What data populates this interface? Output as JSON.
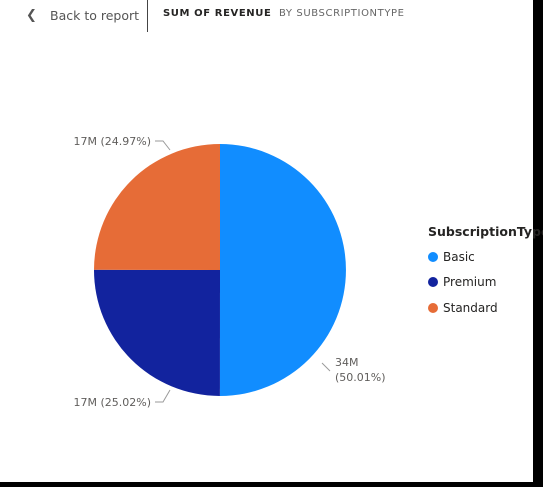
{
  "header": {
    "back_label": "Back to report",
    "metric": "SUM OF REVENUE",
    "dimension": "BY SUBSCRIPTIONTYPE"
  },
  "icons": {
    "back": "chevron-left-icon"
  },
  "colors": {
    "Basic": "#118DFF",
    "Premium": "#12239E",
    "Standard": "#E66C37"
  },
  "chart_data": {
    "type": "pie",
    "categories": [
      "Basic",
      "Premium",
      "Standard"
    ],
    "values": [
      34,
      17,
      17
    ],
    "percentages": [
      50.01,
      25.02,
      24.97
    ],
    "data_labels": [
      "34M\n(50.01%)",
      "17M (25.02%)",
      "17M (24.97%)"
    ],
    "legend_title": "SubscriptionType",
    "legend_position": "right",
    "start_angle_deg": 0,
    "direction": "clockwise"
  }
}
